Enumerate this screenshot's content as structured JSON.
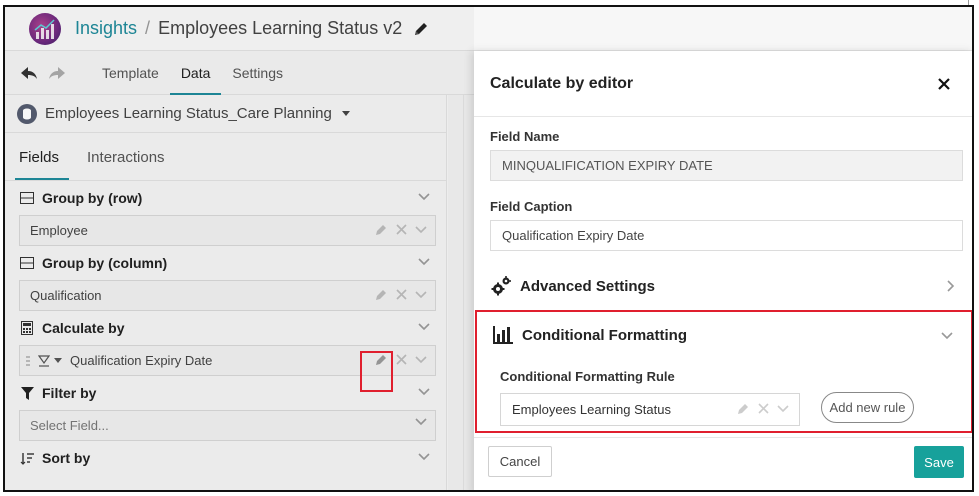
{
  "header": {
    "app_link": "Insights",
    "separator": "/",
    "title": "Employees Learning Status v2"
  },
  "toolbar": {
    "tabs": [
      {
        "label": "Template"
      },
      {
        "label": "Data"
      },
      {
        "label": "Settings"
      }
    ],
    "active_tab": "Data"
  },
  "left_panel": {
    "datasource": "Employees Learning Status_Care Planning",
    "subtabs": [
      {
        "label": "Fields"
      },
      {
        "label": "Interactions"
      }
    ],
    "sections": {
      "group_row": {
        "label": "Group by (row)",
        "value": "Employee"
      },
      "group_column": {
        "label": "Group by (column)",
        "value": "Qualification"
      },
      "calculate_by": {
        "label": "Calculate by",
        "value": "Qualification Expiry Date"
      },
      "filter_by": {
        "label": "Filter by",
        "placeholder": "Select Field..."
      },
      "sort_by": {
        "label": "Sort by"
      }
    }
  },
  "editor": {
    "title": "Calculate by editor",
    "field_name_label": "Field Name",
    "field_name_value": "MINQUALIFICATION EXPIRY DATE",
    "field_caption_label": "Field Caption",
    "field_caption_value": "Qualification Expiry Date",
    "advanced_settings_label": "Advanced Settings",
    "conditional_formatting": {
      "label": "Conditional Formatting",
      "rule_label": "Conditional Formatting Rule",
      "rule_value": "Employees Learning Status",
      "add_rule_label": "Add new rule"
    },
    "cancel_label": "Cancel",
    "save_label": "Save"
  },
  "colors": {
    "accent": "#1e8a9a",
    "save_button": "#17a19b",
    "highlight": "#e01f2e"
  }
}
